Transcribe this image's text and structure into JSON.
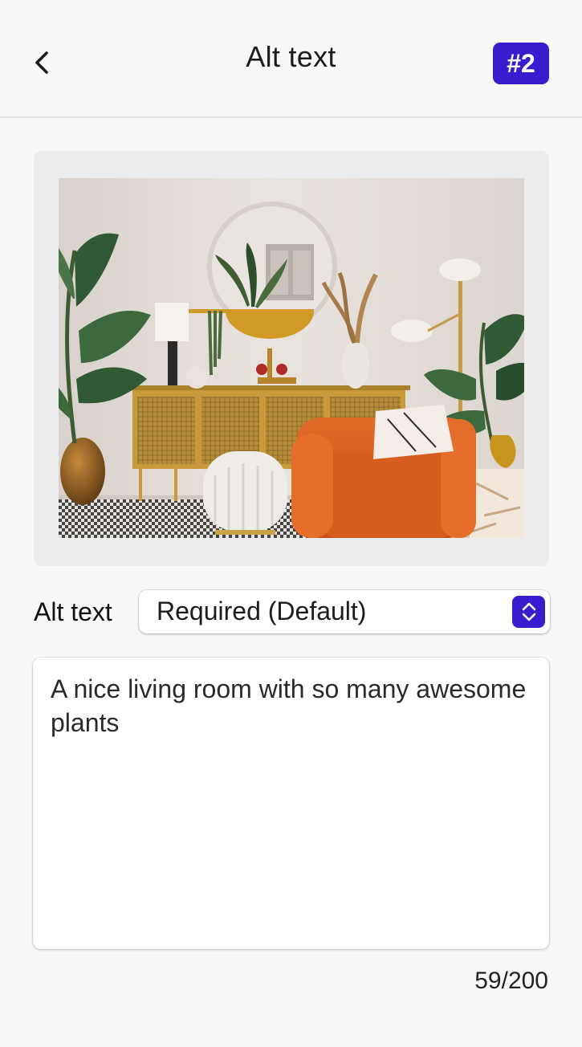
{
  "header": {
    "title": "Alt text",
    "badge": "#2",
    "back_icon": "chevron-left-icon"
  },
  "image": {
    "description_icon": "living-room-photo"
  },
  "alt_text": {
    "label": "Alt text",
    "select_value": "Required (Default)",
    "stepper_icon": "chevron-up-down-icon",
    "text": "A nice living room with so many awesome plants",
    "counter": "59/200"
  },
  "colors": {
    "accent": "#3a1ccf",
    "background": "#f8f8f8",
    "card": "#ececec"
  }
}
